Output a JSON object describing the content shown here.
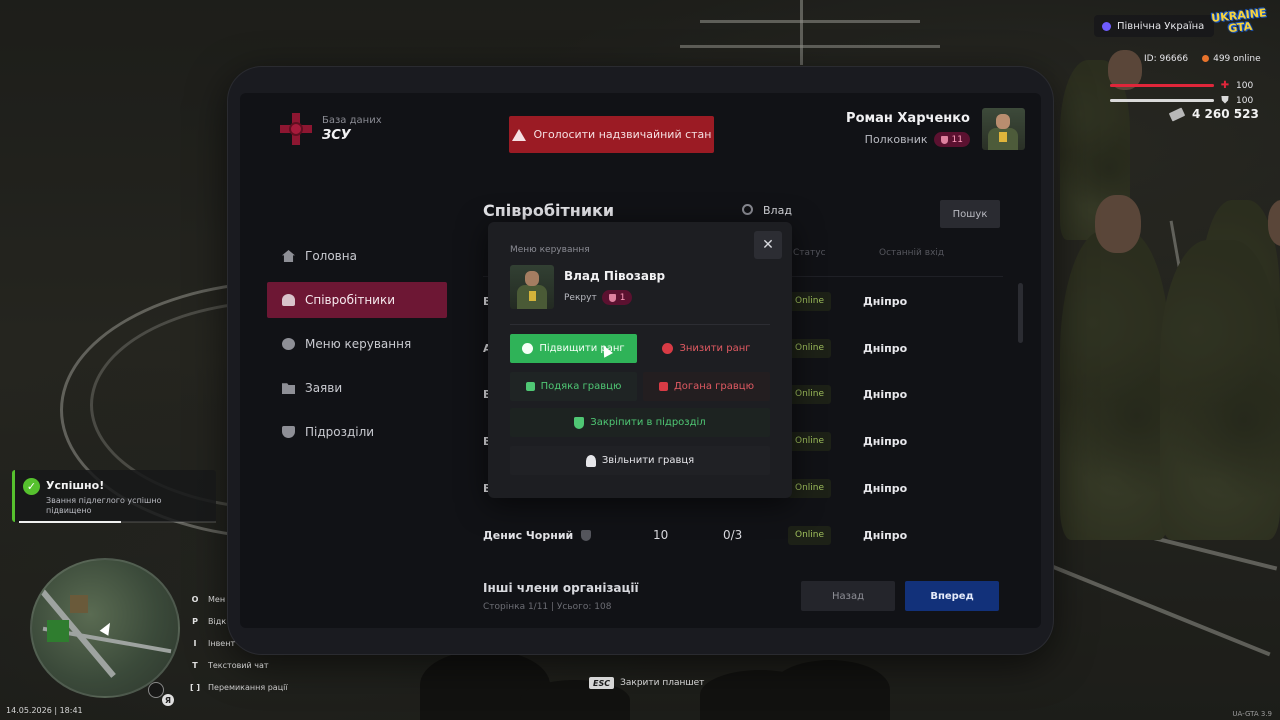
{
  "hud": {
    "server": "Північна Україна",
    "logo": "UKRAINE GTA",
    "id_text": "ID: 96666",
    "online_text": "499 online",
    "health": 100,
    "armor": 100,
    "money": "4 260 523"
  },
  "tablet": {
    "brand_subtitle": "База даних",
    "brand_title": "ЗСУ",
    "alarm_label": "Оголосити надзвичайний стан",
    "profile": {
      "name": "Роман Харченко",
      "rank": "Полковник",
      "rank_level": "11"
    },
    "nav": [
      {
        "label": "Головна",
        "icon": "home-icon",
        "active": false
      },
      {
        "label": "Співробітники",
        "icon": "users-icon",
        "active": true
      },
      {
        "label": "Меню керування",
        "icon": "gear-icon",
        "active": false
      },
      {
        "label": "Заяви",
        "icon": "folder-icon",
        "active": false
      },
      {
        "label": "Підрозділи",
        "icon": "shield-icon",
        "active": false
      }
    ],
    "section_title": "Співробітники",
    "search_value": "Влад",
    "search_button": "Пошук",
    "columns": {
      "status": "Статус",
      "last_login": "Останній вхід"
    },
    "rows": [
      {
        "initial": "В",
        "status": "Online",
        "city": "Дніпро"
      },
      {
        "initial": "А",
        "status": "Online",
        "city": "Дніпро"
      },
      {
        "initial": "В",
        "status": "Online",
        "city": "Дніпро"
      },
      {
        "initial": "В",
        "status": "Online",
        "city": "Дніпро"
      },
      {
        "initial": "В",
        "status": "Online",
        "city": "Дніпро"
      },
      {
        "name": "Денис Чорний",
        "val1": "10",
        "val2": "0/3",
        "status": "Online",
        "city": "Дніпро"
      }
    ],
    "other_title": "Інші члени організації",
    "other_sub": "Сторінка 1/11 | Усього: 108",
    "back_label": "Назад",
    "next_label": "Вперед"
  },
  "modal": {
    "label": "Меню керування",
    "close": "✕",
    "player_name": "Влад Півозавр",
    "player_rank": "Рекрут",
    "player_rank_level": "1",
    "buttons": {
      "promote": "Підвищити ранг",
      "demote": "Знизити ранг",
      "thanks": "Подяка гравцю",
      "reprimand": "Догана гравцю",
      "assign": "Закріпити в підрозділ",
      "fire": "Звільнити гравця"
    }
  },
  "toast": {
    "title": "Успішно!",
    "message": "Звання підлеглого успішно підвищено",
    "progress": 0.52
  },
  "keybinds": [
    {
      "key": "O",
      "label": "Мен"
    },
    {
      "key": "P",
      "label": "Відк"
    },
    {
      "key": "I",
      "label": "Інвент"
    },
    {
      "key": "T",
      "label": "Текстовий чат"
    },
    {
      "key": "[ ]",
      "label": "Перемикання рації"
    }
  ],
  "esc_hint": {
    "key": "ESC",
    "label": "Закрити планшет"
  },
  "datetime": "14.05.2026 | 18:41",
  "minimap_badge": "Я",
  "version": "UA-GTA 3.9"
}
